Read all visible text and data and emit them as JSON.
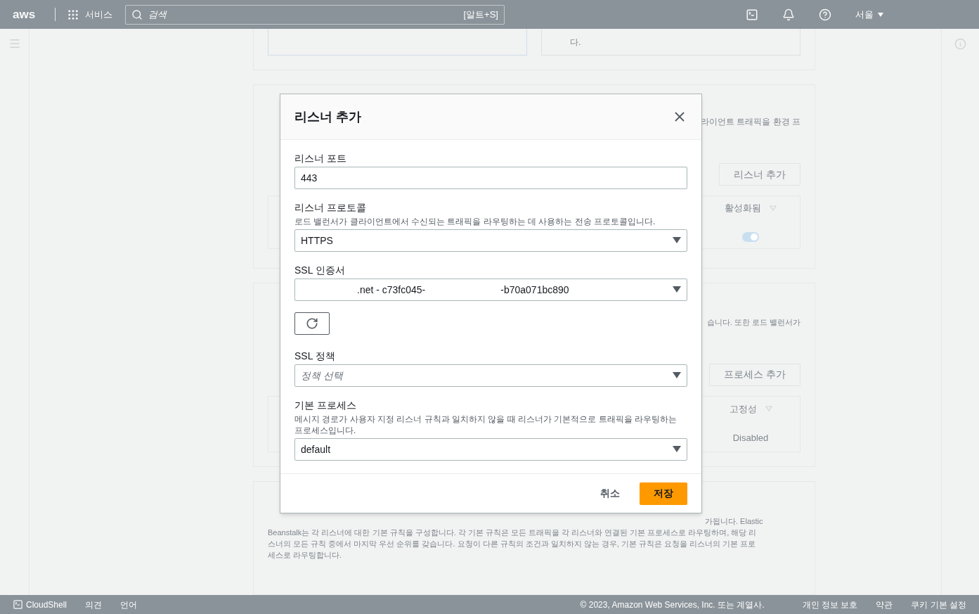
{
  "top_bar": {
    "logo": "aws",
    "services": "서비스",
    "search": {
      "placeholder": "검색",
      "shortcut": "[알트+S]"
    },
    "region": "서울"
  },
  "background": {
    "card_fragment": "다.",
    "listeners": {
      "description_fragment": "라이언트 트래픽을 환경 프",
      "add_button": "리스너 추가",
      "column": "활성화됨",
      "toggle_on": true
    },
    "processes": {
      "description_fragment": "습니다. 또한 로드 밸런서가",
      "add_button": "프로세스 추가",
      "column": "고정성",
      "cell": "Disabled"
    },
    "rules": {
      "description_fragment": "가됩니다. Elastic",
      "description_lines": [
        "Beanstalk는 각 리스너에 대한 기본 규칙을 구성합니다. 각 기본 규칙은 모든 트래픽을 각 리스너와 연결된 기본 프로세스로 라우팅하며, 해당 리",
        "스너의 모든 규칙 중에서 마지막 우선 순위를 갖습니다. 요청이 다른 규칙의 조건과 일치하지 않는 경우, 기본 규칙은 요청을 리스너의 기본 프로",
        "세스로 라우팅합니다."
      ]
    }
  },
  "dialog": {
    "title": "리스너 추가",
    "fields": [
      {
        "kind": "input",
        "label": "리스너 포트",
        "value": "443"
      },
      {
        "kind": "select",
        "label": "리스너 프로토콜",
        "description": "로드 밸런서가 클라이언트에서 수신되는 트래픽을 라우팅하는 데 사용하는 전송 프로토콜입니다.",
        "value": "HTTPS"
      },
      {
        "kind": "select",
        "label": "SSL 인증서",
        "value_parts": [
          ".net - c73fc045-",
          "-b70a071bc890"
        ]
      },
      {
        "kind": "refresh"
      },
      {
        "kind": "select",
        "label": "SSL 정책",
        "placeholder": "정책 선택"
      },
      {
        "kind": "select",
        "label": "기본 프로세스",
        "description": "메시지 경로가 사용자 지정 리스너 규칙과 일치하지 않을 때 리스너가 기본적으로 트래픽을 라우팅하는 프로세스입니다.",
        "value": "default"
      }
    ],
    "buttons": [
      {
        "kind": "link",
        "label": "취소"
      },
      {
        "kind": "primary",
        "label": "저장"
      }
    ]
  },
  "footer": {
    "left": [
      "CloudShell",
      "의견",
      "언어"
    ],
    "copyright": "© 2023, Amazon Web Services, Inc. 또는 계열사.",
    "links": [
      "개인 정보 보호",
      "약관",
      "쿠키 기본 설정"
    ]
  }
}
